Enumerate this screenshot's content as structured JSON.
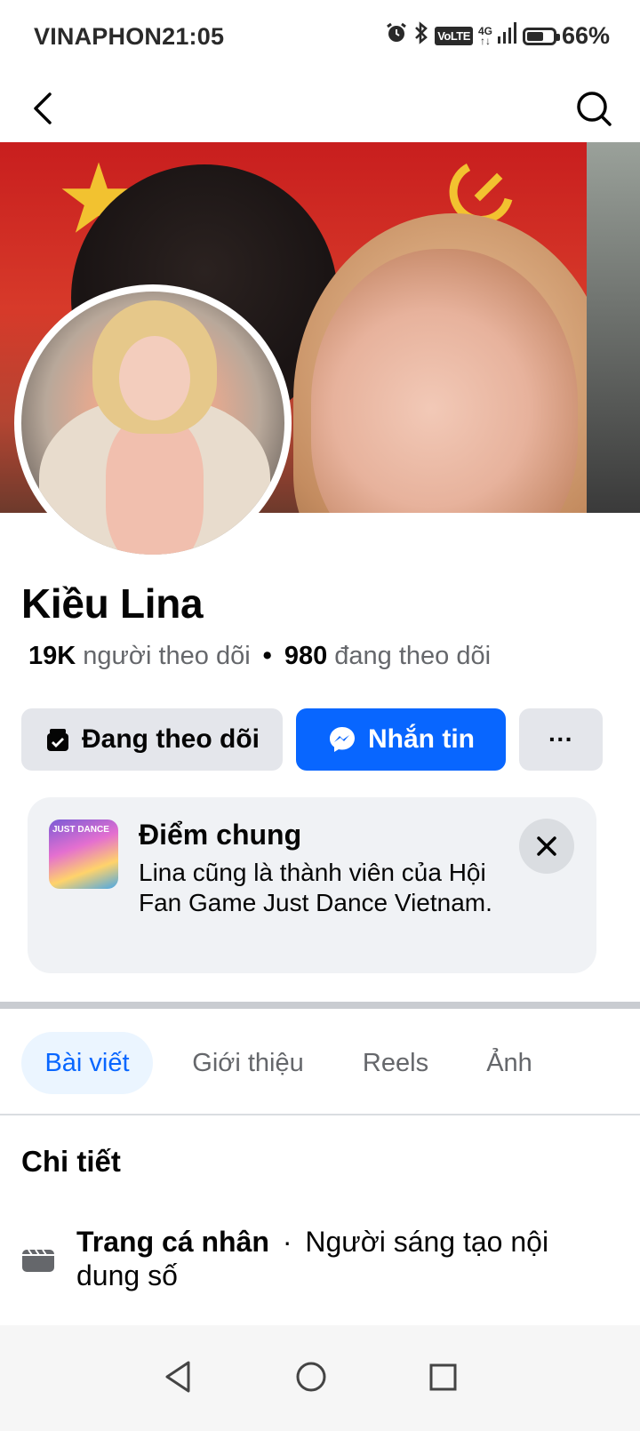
{
  "status_bar": {
    "carrier": "VINAPHON",
    "time": "21:05",
    "volte": "VoLTE",
    "network": "4G",
    "battery_percent": "66%",
    "battery_level": 0.66,
    "icons": [
      "alarm-icon",
      "bluetooth-icon",
      "volte-icon",
      "signal-icon",
      "battery-icon"
    ]
  },
  "topnav": {
    "back_icon": "chevron-left-icon",
    "search_icon": "search-icon"
  },
  "profile": {
    "name": "Kiều Lina",
    "followers_count": "19K",
    "followers_label": "người theo dõi",
    "following_count": "980",
    "following_label": "đang theo dõi"
  },
  "actions": {
    "follow_label": "Đang theo dõi",
    "message_label": "Nhắn tin",
    "more_label": "···"
  },
  "mutual": {
    "title": "Điểm chung",
    "description": "Lina cũng là thành viên của Hội Fan Game Just Dance Vietnam."
  },
  "tabs": [
    {
      "label": "Bài viết",
      "active": true
    },
    {
      "label": "Giới thiệu",
      "active": false
    },
    {
      "label": "Reels",
      "active": false
    },
    {
      "label": "Ảnh",
      "active": false
    }
  ],
  "details": {
    "title": "Chi tiết",
    "page_type_label": "Trang cá nhân",
    "page_type_value": "Người sáng tạo nội dung số"
  },
  "colors": {
    "accent": "#0866ff",
    "tab_active_bg": "#ebf5ff",
    "button_gray": "#e4e6eb",
    "card_bg": "#f0f2f5"
  }
}
